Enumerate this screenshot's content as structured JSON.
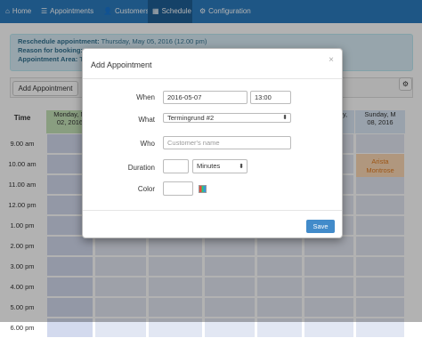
{
  "nav": {
    "items": [
      {
        "icon": "⌂",
        "label": "Home"
      },
      {
        "icon": "☰",
        "label": "Appointments"
      },
      {
        "icon": "👤",
        "label": "Customers"
      },
      {
        "icon": "▦",
        "label": "Schedule"
      },
      {
        "icon": "⚙",
        "label": "Configuration"
      }
    ]
  },
  "alert": {
    "reschedule_label": "Reschedule appointment:",
    "reschedule_value": "Thursday, May 05, 2016 (12.00 pm)",
    "reason_label": "Reason for booking:",
    "reason_value": "T",
    "area_label": "Appointment Area:",
    "area_value": "Te"
  },
  "toolbar": {
    "add_label": "Add Appointment",
    "settings_icon": "⚙"
  },
  "calendar": {
    "time_header": "Time",
    "monday_header": [
      "Monday, M",
      "02, 2016"
    ],
    "sunday_header": [
      "Sunday, M",
      "08, 2016"
    ],
    "partial_col_header": "y,",
    "times": [
      "9.00 am",
      "10.00 am",
      "11.00 am",
      "12.00 pm",
      "1.00 pm",
      "2.00 pm",
      "3.00 pm",
      "4.00 pm",
      "5.00 pm",
      "6.00 pm"
    ],
    "appointment": {
      "line1": "Arista",
      "line2": "Montrose"
    }
  },
  "modal": {
    "title": "Add Appointment",
    "close": "×",
    "when_label": "When",
    "date_value": "2016-05-07",
    "time_value": "13:00",
    "what_label": "What",
    "what_value": "Termingrund #2",
    "who_label": "Who",
    "who_placeholder": "Customer's name",
    "duration_label": "Duration",
    "duration_value": "",
    "duration_unit": "Minutes",
    "color_label": "Color",
    "save_label": "Save"
  },
  "colors": {
    "navbar": "#2b7bbf",
    "accent": "#428bca",
    "slot": "#e2e7f3",
    "appointment": "#fcd9b5",
    "header_green": "#c4e2b8",
    "header_blue": "#dce9f7"
  }
}
